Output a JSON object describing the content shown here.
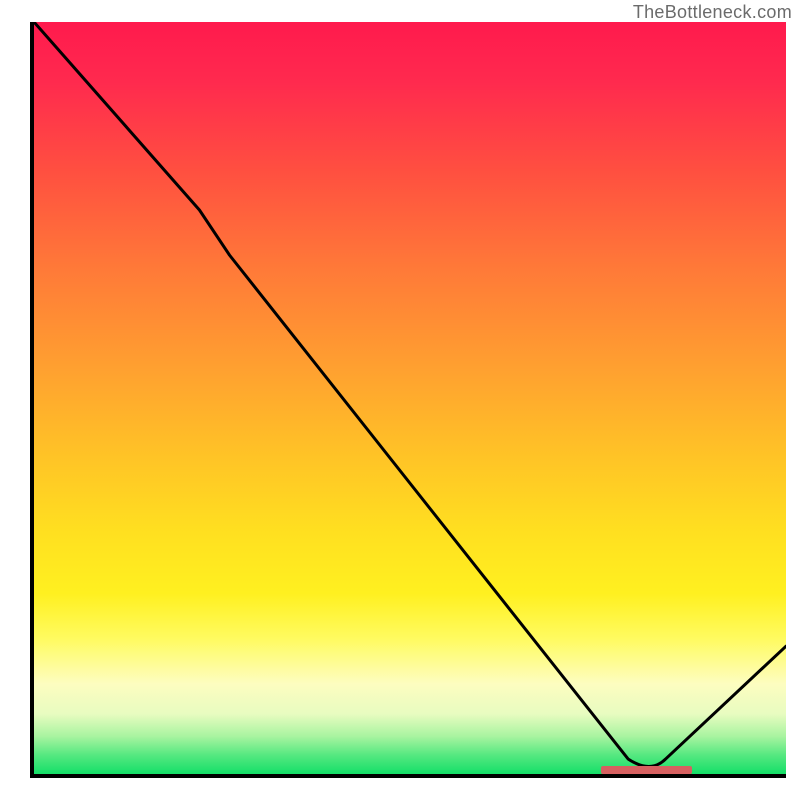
{
  "watermark": "TheBottleneck.com",
  "colors": {
    "line": "#000000",
    "marker": "#d66060",
    "border": "#000000",
    "gradient_top": "#ff1a4d",
    "gradient_bottom": "#14df68"
  },
  "chart_data": {
    "type": "line",
    "title": "",
    "xlabel": "",
    "ylabel": "",
    "xlim": [
      0,
      100
    ],
    "ylim": [
      0,
      100
    ],
    "x": [
      0,
      24,
      82,
      100
    ],
    "values": [
      100,
      72,
      0,
      17
    ],
    "marker_segment": {
      "x_start": 75,
      "x_end": 87,
      "y": 0
    }
  }
}
